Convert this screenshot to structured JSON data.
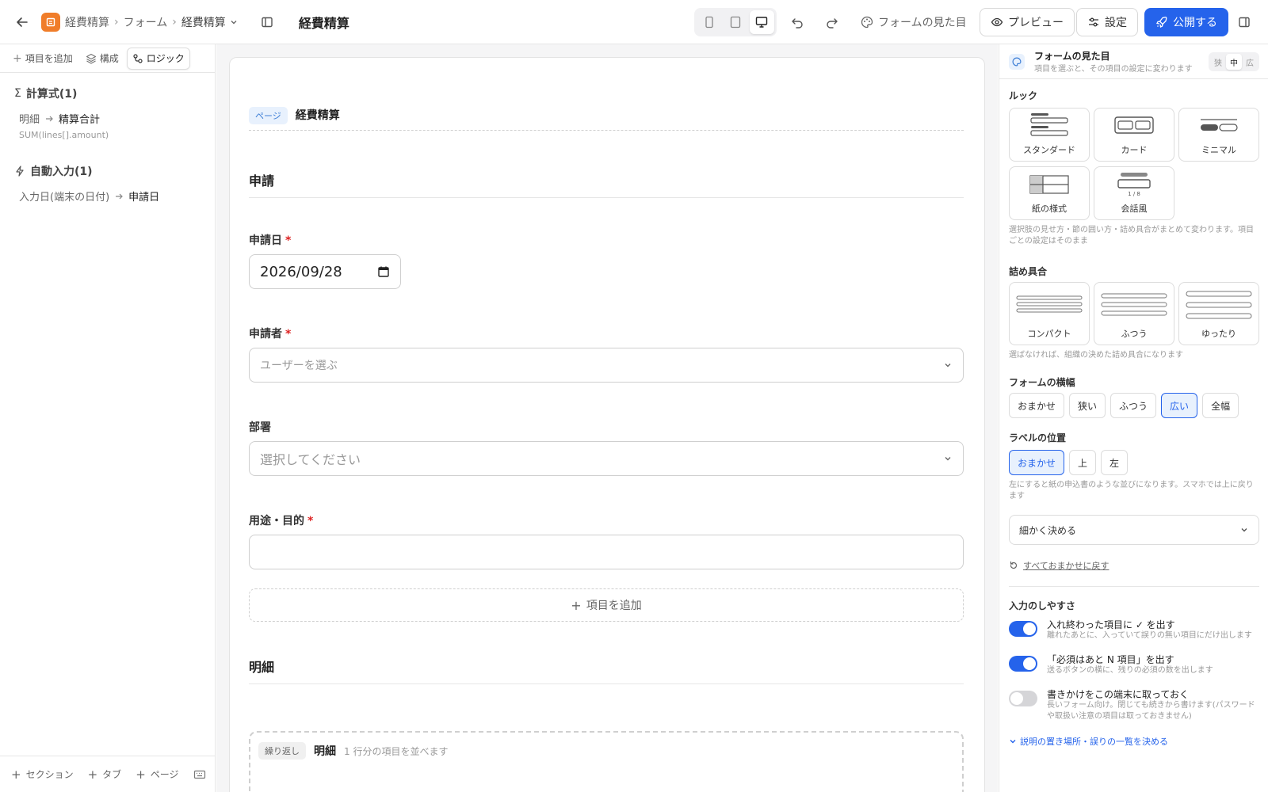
{
  "topbar": {
    "breadcrumb": [
      "経費精算",
      "フォーム"
    ],
    "current_form": "経費精算",
    "title": "経費精算",
    "look_label": "フォームの見た目",
    "preview_label": "プレビュー",
    "settings_label": "設定",
    "publish_label": "公開する",
    "devices": [
      "mobile",
      "tablet",
      "desktop"
    ],
    "active_device": "desktop"
  },
  "left": {
    "tabs": [
      {
        "label": "項目を追加",
        "icon": "plus-icon"
      },
      {
        "label": "構成",
        "icon": "layers-icon"
      },
      {
        "label": "ロジック",
        "icon": "logic-icon",
        "active": true
      }
    ],
    "formulas": {
      "title": "計算式(1)",
      "items": [
        {
          "src": "明細",
          "dst": "精算合計",
          "expr": "SUM(lines[].amount)"
        }
      ]
    },
    "autofill": {
      "title": "自動入力(1)",
      "items": [
        {
          "src": "入力日(端末の日付)",
          "dst": "申請日"
        }
      ]
    },
    "footer": [
      "セクション",
      "タブ",
      "ページ"
    ]
  },
  "canvas": {
    "page_badge": "ページ",
    "page_name": "経費精算",
    "section1": "申請",
    "fields": [
      {
        "label": "申請日",
        "required": true,
        "value": "2026/09/28"
      },
      {
        "label": "申請者",
        "required": true,
        "placeholder": "ユーザーを選ぶ"
      },
      {
        "label": "部署",
        "required": false,
        "placeholder": "選択してください"
      },
      {
        "label": "用途・目的",
        "required": true,
        "value": ""
      }
    ],
    "add_item": "項目を追加",
    "section2": "明細",
    "repeat": {
      "badge": "繰り返し",
      "title": "明細",
      "desc": "1 行分の項目を並べます"
    }
  },
  "right": {
    "title": "フォームの見た目",
    "subtitle": "項目を選ぶと、その項目の設定に変わります",
    "width_seg": [
      "狭",
      "中",
      "広"
    ],
    "width_seg_active": "中",
    "look": {
      "label": "ルック",
      "options": [
        "スタンダード",
        "カード",
        "ミニマル",
        "紙の様式",
        "会話風"
      ],
      "chat_counter": "1 / 8",
      "help": "選択肢の見せ方・節の囲い方・詰め具合がまとめて変わります。項目ごとの設定はそのまま"
    },
    "density": {
      "label": "詰め具合",
      "options": [
        "コンパクト",
        "ふつう",
        "ゆったり"
      ],
      "help": "選ばなければ、組織の決めた詰め具合になります"
    },
    "form_width": {
      "label": "フォームの横幅",
      "options": [
        "おまかせ",
        "狭い",
        "ふつう",
        "広い",
        "全幅"
      ],
      "selected": "広い"
    },
    "label_pos": {
      "label": "ラベルの位置",
      "options": [
        "おまかせ",
        "上",
        "左"
      ],
      "selected": "おまかせ",
      "help": "左にすると紙の申込書のような並びになります。スマホでは上に戻ります"
    },
    "detail_select": "細かく決める",
    "reset_label": "すべておまかせに戻す",
    "usability": {
      "label": "入力のしやすさ",
      "toggles": [
        {
          "title": "入れ終わった項目に ✓ を出す",
          "desc": "離れたあとに、入っていて誤りの無い項目にだけ出します",
          "on": true
        },
        {
          "title": "「必須はあと N 項目」を出す",
          "desc": "送るボタンの横に、残りの必須の数を出します",
          "on": true
        },
        {
          "title": "書きかけをこの端末に取っておく",
          "desc": "長いフォーム向け。閉じても続きから書けます(パスワードや取扱い注意の項目は取っておきません)",
          "on": false
        }
      ],
      "more_link": "説明の置き場所・誤りの一覧を決める"
    }
  }
}
